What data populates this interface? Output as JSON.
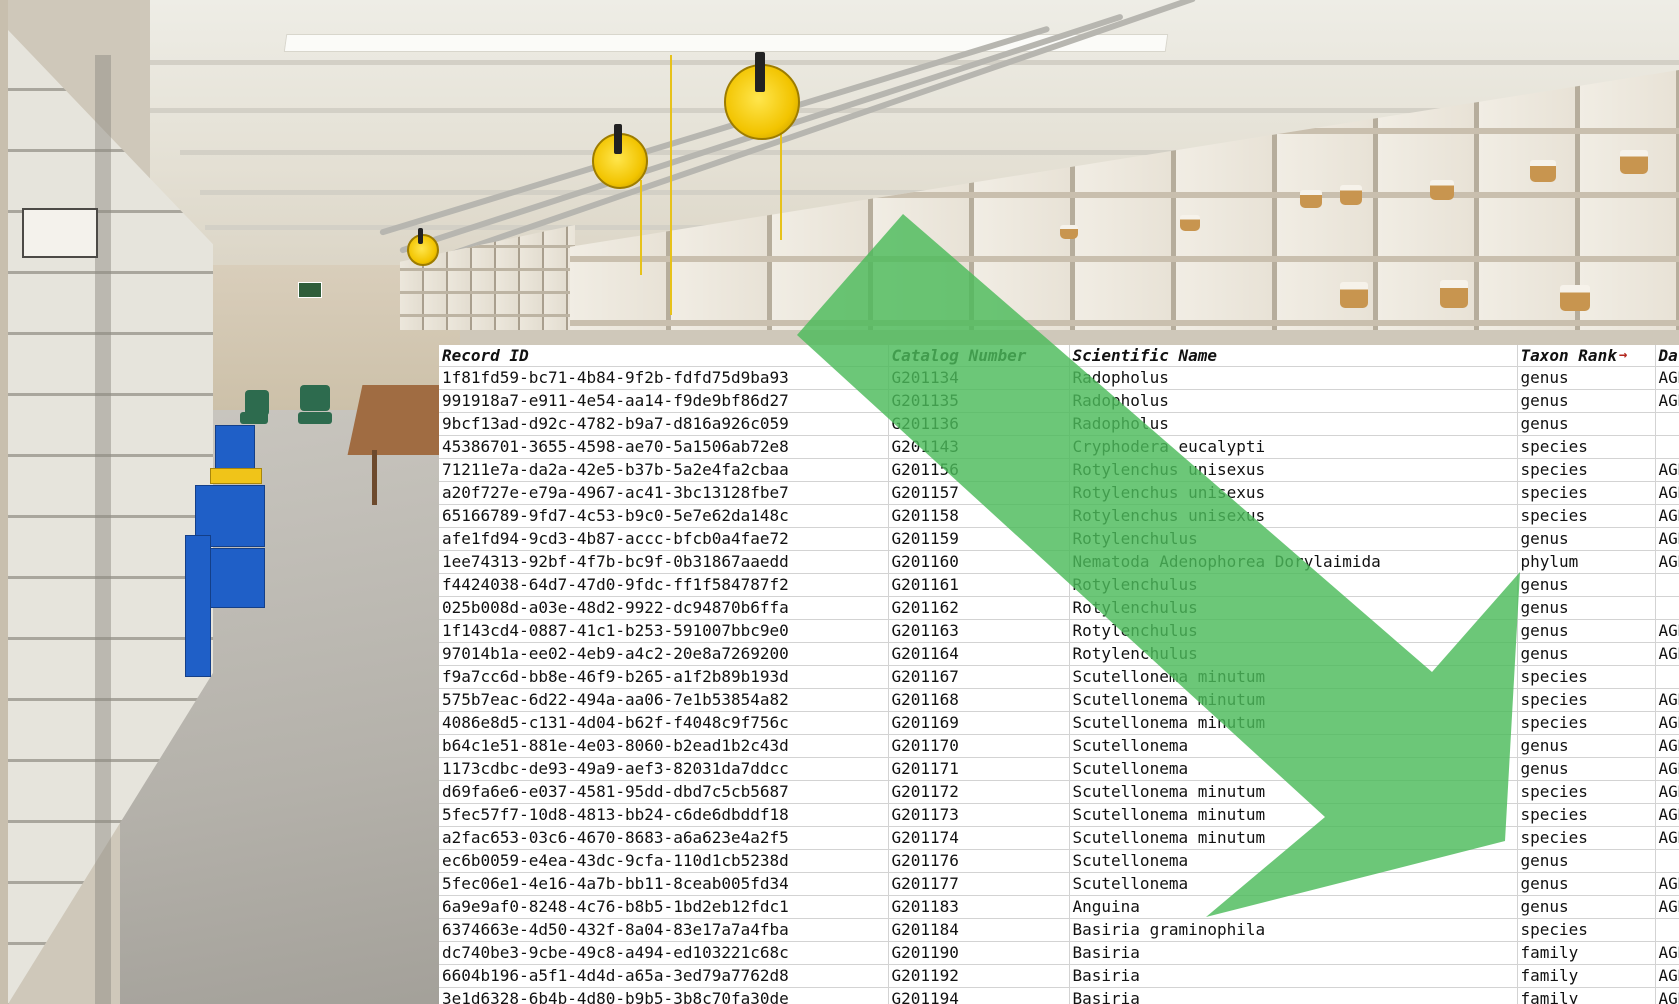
{
  "table": {
    "headers": {
      "record_id": "Record ID",
      "catalog_number": "Catalog Number",
      "scientific_name": "Scientific Name",
      "taxon_rank": "Taxon Rank",
      "date": "Dat"
    },
    "rows": [
      {
        "record_id": "1f81fd59-bc71-4b84-9f2b-fdfd75d9ba93",
        "catalog_number": "G201134",
        "scientific_name": "Radopholus",
        "taxon_rank": "genus",
        "date": "AGD"
      },
      {
        "record_id": "991918a7-e911-4e54-aa14-f9de9bf86d27",
        "catalog_number": "G201135",
        "scientific_name": "Radopholus",
        "taxon_rank": "genus",
        "date": "AGD"
      },
      {
        "record_id": "9bcf13ad-d92c-4782-b9a7-d816a926c059",
        "catalog_number": "G201136",
        "scientific_name": "Radopholus",
        "taxon_rank": "genus",
        "date": ""
      },
      {
        "record_id": "45386701-3655-4598-ae70-5a1506ab72e8",
        "catalog_number": "G201143",
        "scientific_name": "Cryphodera eucalypti",
        "taxon_rank": "species",
        "date": ""
      },
      {
        "record_id": "71211e7a-da2a-42e5-b37b-5a2e4fa2cbaa",
        "catalog_number": "G201156",
        "scientific_name": "Rotylenchus unisexus",
        "taxon_rank": "species",
        "date": "AGD"
      },
      {
        "record_id": "a20f727e-e79a-4967-ac41-3bc13128fbe7",
        "catalog_number": "G201157",
        "scientific_name": "Rotylenchus unisexus",
        "taxon_rank": "species",
        "date": "AGD"
      },
      {
        "record_id": "65166789-9fd7-4c53-b9c0-5e7e62da148c",
        "catalog_number": "G201158",
        "scientific_name": "Rotylenchus unisexus",
        "taxon_rank": "species",
        "date": "AGD"
      },
      {
        "record_id": "afe1fd94-9cd3-4b87-accc-bfcb0a4fae72",
        "catalog_number": "G201159",
        "scientific_name": "Rotylenchulus",
        "taxon_rank": "genus",
        "date": "AGD"
      },
      {
        "record_id": "1ee74313-92bf-4f7b-bc9f-0b31867aaedd",
        "catalog_number": "G201160",
        "scientific_name": "Nematoda Adenophorea Dorylaimida",
        "taxon_rank": "phylum",
        "date": "AGD"
      },
      {
        "record_id": "f4424038-64d7-47d0-9fdc-ff1f584787f2",
        "catalog_number": "G201161",
        "scientific_name": "Rotylenchulus",
        "taxon_rank": "genus",
        "date": ""
      },
      {
        "record_id": "025b008d-a03e-48d2-9922-dc94870b6ffa",
        "catalog_number": "G201162",
        "scientific_name": "Rotylenchulus",
        "taxon_rank": "genus",
        "date": ""
      },
      {
        "record_id": "1f143cd4-0887-41c1-b253-591007bbc9e0",
        "catalog_number": "G201163",
        "scientific_name": "Rotylenchulus",
        "taxon_rank": "genus",
        "date": "AGD"
      },
      {
        "record_id": "97014b1a-ee02-4eb9-a4c2-20e8a7269200",
        "catalog_number": "G201164",
        "scientific_name": "Rotylenchulus",
        "taxon_rank": "genus",
        "date": "AGD"
      },
      {
        "record_id": "f9a7cc6d-bb8e-46f9-b265-a1f2b89b193d",
        "catalog_number": "G201167",
        "scientific_name": "Scutellonema minutum",
        "taxon_rank": "species",
        "date": ""
      },
      {
        "record_id": "575b7eac-6d22-494a-aa06-7e1b53854a82",
        "catalog_number": "G201168",
        "scientific_name": "Scutellonema minutum",
        "taxon_rank": "species",
        "date": "AGD"
      },
      {
        "record_id": "4086e8d5-c131-4d04-b62f-f4048c9f756c",
        "catalog_number": "G201169",
        "scientific_name": "Scutellonema minutum",
        "taxon_rank": "species",
        "date": "AGD"
      },
      {
        "record_id": "b64c1e51-881e-4e03-8060-b2ead1b2c43d",
        "catalog_number": "G201170",
        "scientific_name": "Scutellonema",
        "taxon_rank": "genus",
        "date": "AGD"
      },
      {
        "record_id": "1173cdbc-de93-49a9-aef3-82031da7ddcc",
        "catalog_number": "G201171",
        "scientific_name": "Scutellonema",
        "taxon_rank": "genus",
        "date": "AGD"
      },
      {
        "record_id": "d69fa6e6-e037-4581-95dd-dbd7c5cb5687",
        "catalog_number": "G201172",
        "scientific_name": "Scutellonema minutum",
        "taxon_rank": "species",
        "date": "AGD"
      },
      {
        "record_id": "5fec57f7-10d8-4813-bb24-c6de6dbddf18",
        "catalog_number": "G201173",
        "scientific_name": "Scutellonema minutum",
        "taxon_rank": "species",
        "date": "AGD"
      },
      {
        "record_id": "a2fac653-03c6-4670-8683-a6a623e4a2f5",
        "catalog_number": "G201174",
        "scientific_name": "Scutellonema minutum",
        "taxon_rank": "species",
        "date": "AGD"
      },
      {
        "record_id": "ec6b0059-e4ea-43dc-9cfa-110d1cb5238d",
        "catalog_number": "G201176",
        "scientific_name": "Scutellonema",
        "taxon_rank": "genus",
        "date": ""
      },
      {
        "record_id": "5fec06e1-4e16-4a7b-bb11-8ceab005fd34",
        "catalog_number": "G201177",
        "scientific_name": "Scutellonema",
        "taxon_rank": "genus",
        "date": "AGD"
      },
      {
        "record_id": "6a9e9af0-8248-4c76-b8b5-1bd2eb12fdc1",
        "catalog_number": "G201183",
        "scientific_name": "Anguina",
        "taxon_rank": "genus",
        "date": "AGD"
      },
      {
        "record_id": "6374663e-4d50-432f-8a04-83e17a7a4fba",
        "catalog_number": "G201184",
        "scientific_name": "Basiria graminophila",
        "taxon_rank": "species",
        "date": ""
      },
      {
        "record_id": "dc740be3-9cbe-49c8-a494-ed103221c68c",
        "catalog_number": "G201190",
        "scientific_name": "Basiria",
        "taxon_rank": "family",
        "date": "AGD"
      },
      {
        "record_id": "6604b196-a5f1-4d4d-a65a-3ed79a7762d8",
        "catalog_number": "G201192",
        "scientific_name": "Basiria",
        "taxon_rank": "family",
        "date": "AGD"
      },
      {
        "record_id": "3e1d6328-6b4b-4d80-b9b5-3b8c70fa30de",
        "catalog_number": "G201194",
        "scientific_name": "Basiria",
        "taxon_rank": "family",
        "date": "AGD"
      }
    ]
  },
  "colors": {
    "arrow": "#4cbb5a",
    "sort_indicator": "#b3261e",
    "cord_reel": "#f2c400",
    "storage_bins": "#1f5fc7"
  },
  "icons": {
    "sort": "arrow-right-icon"
  }
}
